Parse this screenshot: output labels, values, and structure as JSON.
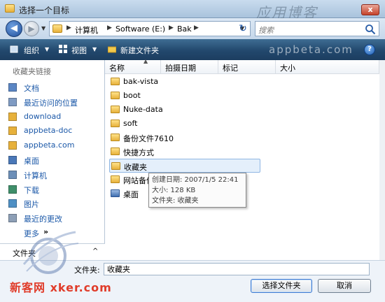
{
  "window": {
    "title": "选择一个目标",
    "watermark_top": "应用博客",
    "close_label": "x"
  },
  "address": {
    "crumbs": [
      "计算机",
      "Software (E:)",
      "Bak"
    ],
    "search_placeholder": "搜索"
  },
  "toolbar": {
    "organize_label": "组织",
    "view_label": "视图",
    "new_folder_label": "新建文件夹",
    "watermark": "appbeta.com",
    "help_label": "?"
  },
  "sidebar": {
    "header": "收藏夹链接",
    "items": [
      {
        "label": "文档",
        "icon": "documents-icon"
      },
      {
        "label": "最近访问的位置",
        "icon": "recent-places-icon"
      },
      {
        "label": "download",
        "icon": "folder-icon"
      },
      {
        "label": "appbeta-doc",
        "icon": "folder-icon"
      },
      {
        "label": "appbeta.com",
        "icon": "folder-icon"
      },
      {
        "label": "桌面",
        "icon": "desktop-icon"
      },
      {
        "label": "计算机",
        "icon": "computer-icon"
      },
      {
        "label": "下载",
        "icon": "downloads-icon"
      },
      {
        "label": "图片",
        "icon": "pictures-icon"
      },
      {
        "label": "最近的更改",
        "icon": "recent-changes-icon"
      }
    ],
    "more_label": "更多",
    "more_arrow": "»",
    "folders_label": "文件夹",
    "folders_caret": "^"
  },
  "columns": [
    "名称",
    "拍摄日期",
    "标记",
    "大小"
  ],
  "files": [
    {
      "name": "bak-vista",
      "icon": "folder-icon"
    },
    {
      "name": "boot",
      "icon": "folder-icon"
    },
    {
      "name": "Nuke-data",
      "icon": "folder-icon"
    },
    {
      "name": "soft",
      "icon": "folder-icon"
    },
    {
      "name": "备份文件7610",
      "icon": "folder-icon"
    },
    {
      "name": "快捷方式",
      "icon": "folder-icon"
    },
    {
      "name": "收藏夹",
      "icon": "favorites-folder-icon",
      "selected": true
    },
    {
      "name": "网站备份",
      "icon": "folder-icon"
    },
    {
      "name": "桌面",
      "icon": "desktop-icon"
    }
  ],
  "tooltip": {
    "created": "创建日期: 2007/1/5 22:41",
    "size": "大小: 128 KB",
    "folder": "文件夹: 收藏夹"
  },
  "bottom": {
    "filename_label": "文件夹:",
    "filename_value": "收藏夹",
    "select_button": "选择文件夹",
    "cancel_button": "取消"
  },
  "watermark_bottom": {
    "site": "新客网 xker.com"
  },
  "colors": {
    "toolbar_bg": "#22486d",
    "link": "#1b58a8",
    "selection": "#e4effb"
  }
}
